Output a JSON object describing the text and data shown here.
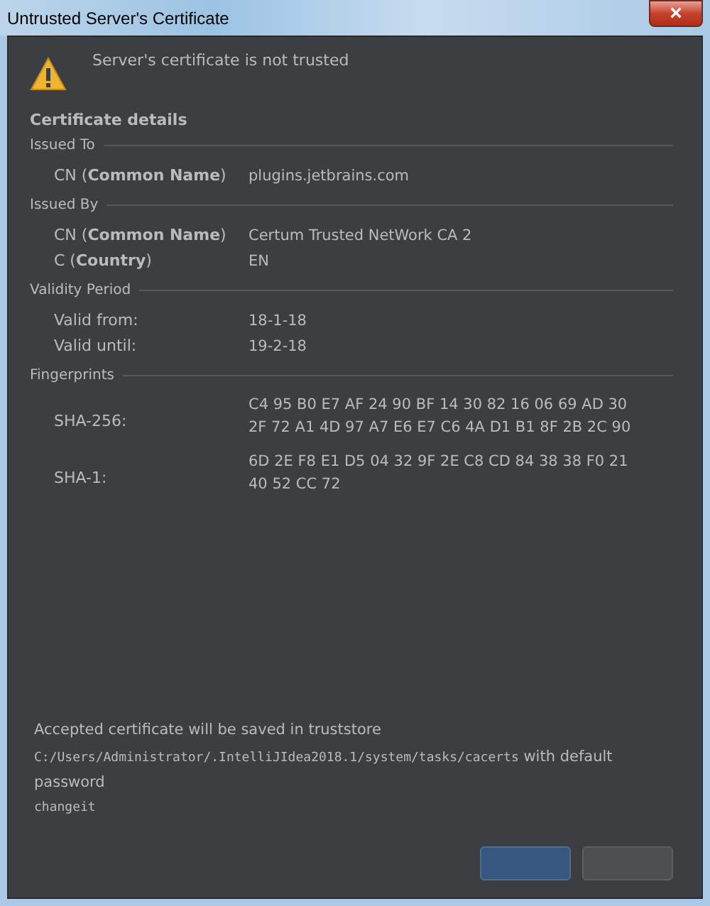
{
  "window": {
    "title": "Untrusted Server's Certificate",
    "close": "×"
  },
  "message": "Server's certificate is not trusted",
  "details_title": "Certificate details",
  "sections": [
    {
      "title": "Issued To",
      "rows": [
        {
          "label": "CN (**Common Name**)",
          "value": "plugins.jetbrains.com"
        }
      ]
    },
    {
      "title": "Issued By",
      "rows": [
        {
          "label": "CN (**Common Name**)",
          "value": "Certum Trusted NetWork CA 2"
        },
        {
          "label": "C (**Country**)",
          "value": "EN"
        }
      ]
    },
    {
      "title": "Validity Period",
      "rows": [
        {
          "label": "Valid from:",
          "value": "18-1-18"
        },
        {
          "label": "Valid until:",
          "value": "19-2-18"
        }
      ]
    },
    {
      "title": "Fingerprints",
      "rows": [
        {
          "label": "SHA-256:",
          "value": "C4 95 B0 E7 AF 24 90 BF 14 30 82 16 06 69 AD 30 2F 72 A1 4D 97 A7 E6 E7 C6 4A D1 B1 8F 2B 2C 90"
        },
        {
          "label": "SHA-1:",
          "value": "6D 2E F8 E1 D5 04 32 9F 2E C8 CD 84 38 38 F0 21 40 52 CC 72"
        }
      ]
    }
  ],
  "footer": {
    "note": "Accepted certificate will be saved in truststore",
    "path": "C:/Users/Administrator/.IntelliJIdea2018.1/system/tasks/cacerts",
    "path_suffix": "with default password",
    "password": "changeit"
  },
  "buttons": [
    {
      "kind": "default"
    },
    {
      "kind": "plain"
    }
  ]
}
